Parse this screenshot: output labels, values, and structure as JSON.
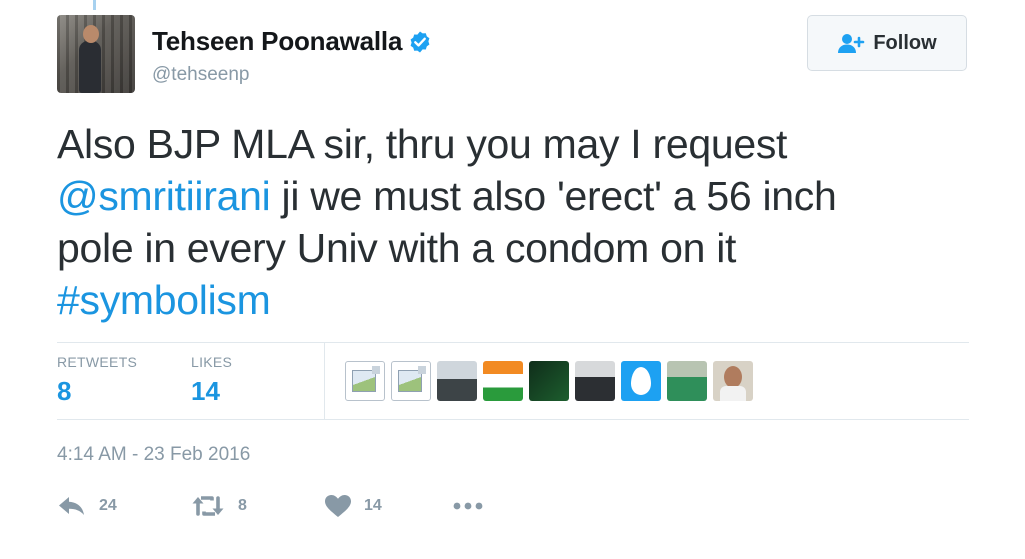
{
  "author": {
    "name": "Tehseen Poonawalla",
    "handle": "@tehseenp"
  },
  "follow_button": {
    "label": "Follow"
  },
  "tweet": {
    "line1": "Also BJP MLA sir, thru you may I request",
    "mention": "@smritiirani",
    "line2_rest": " ji we must also 'erect' a 56 inch",
    "line3": "pole in every Univ with a condom on it",
    "hashtag": "#symbolism"
  },
  "stats": {
    "retweets_label": "RETWEETS",
    "retweets_value": "8",
    "likes_label": "LIKES",
    "likes_value": "14"
  },
  "likers": [
    "broken-image-icon",
    "broken-image-icon",
    "group-photo",
    "congress-flag",
    "green-photo",
    "person-photo",
    "egg-avatar",
    "person-green-photo",
    "man-portrait"
  ],
  "timestamp": "4:14 AM - 23 Feb 2016",
  "actions": {
    "reply_count": "24",
    "retweet_count": "8",
    "like_count": "14"
  },
  "colors": {
    "link": "#1b95e0",
    "verified": "#1da1f2",
    "muted": "#8899a6",
    "text": "#292f33"
  }
}
